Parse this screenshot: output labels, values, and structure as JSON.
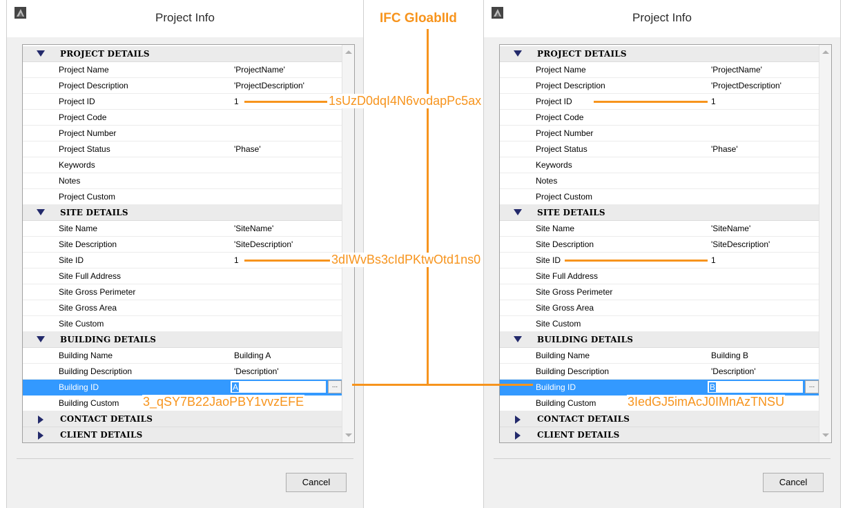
{
  "annotation_title": "IFC GloabIId",
  "annotations": {
    "project_guid": "1sUzD0dqI4N6vodapPc5ax",
    "site_guid": "3dIWvBs3cIdPKtwOtd1ns0",
    "building_guid_left": "3_qSY7B22JaoPBY1vvzEFE",
    "building_guid_right": "3IedGJ5imAcJ0IMnAzTNSU"
  },
  "colors": {
    "annotation": "#f7941d",
    "selection": "#3399ff",
    "triangle": "#232a6b"
  },
  "dialogs": [
    {
      "title": "Project Info",
      "cancel_label": "Cancel",
      "more_label": "...",
      "rows": [
        {
          "type": "section",
          "label": "PROJECT DETAILS",
          "expanded": true
        },
        {
          "label": "Project Name",
          "value": "'ProjectName'"
        },
        {
          "label": "Project Description",
          "value": "'ProjectDescription'"
        },
        {
          "label": "Project ID",
          "value": "1"
        },
        {
          "label": "Project Code",
          "value": ""
        },
        {
          "label": "Project Number",
          "value": ""
        },
        {
          "label": "Project Status",
          "value": "'Phase'"
        },
        {
          "label": "Keywords",
          "value": ""
        },
        {
          "label": "Notes",
          "value": ""
        },
        {
          "label": "Project Custom",
          "value": ""
        },
        {
          "type": "section",
          "label": "SITE DETAILS",
          "expanded": true
        },
        {
          "label": "Site Name",
          "value": "'SiteName'"
        },
        {
          "label": "Site Description",
          "value": "'SiteDescription'"
        },
        {
          "label": "Site ID",
          "value": "1"
        },
        {
          "label": "Site Full Address",
          "value": ""
        },
        {
          "label": "Site Gross Perimeter",
          "value": ""
        },
        {
          "label": "Site Gross Area",
          "value": ""
        },
        {
          "label": "Site Custom",
          "value": ""
        },
        {
          "type": "section",
          "label": "BUILDING DETAILS",
          "expanded": true
        },
        {
          "label": "Building Name",
          "value": "Building A"
        },
        {
          "label": "Building Description",
          "value": "'Description'"
        },
        {
          "label": "Building ID",
          "value": "A",
          "selected": true
        },
        {
          "label": "Building Custom",
          "value": ""
        },
        {
          "type": "section",
          "label": "CONTACT DETAILS",
          "expanded": false
        },
        {
          "type": "section",
          "label": "CLIENT DETAILS",
          "expanded": false
        }
      ]
    },
    {
      "title": "Project Info",
      "cancel_label": "Cancel",
      "more_label": "...",
      "rows": [
        {
          "type": "section",
          "label": "PROJECT DETAILS",
          "expanded": true
        },
        {
          "label": "Project Name",
          "value": "'ProjectName'"
        },
        {
          "label": "Project Description",
          "value": "'ProjectDescription'"
        },
        {
          "label": "Project ID",
          "value": "1"
        },
        {
          "label": "Project Code",
          "value": ""
        },
        {
          "label": "Project Number",
          "value": ""
        },
        {
          "label": "Project Status",
          "value": "'Phase'"
        },
        {
          "label": "Keywords",
          "value": ""
        },
        {
          "label": "Notes",
          "value": ""
        },
        {
          "label": "Project Custom",
          "value": ""
        },
        {
          "type": "section",
          "label": "SITE DETAILS",
          "expanded": true
        },
        {
          "label": "Site Name",
          "value": "'SiteName'"
        },
        {
          "label": "Site Description",
          "value": "'SiteDescription'"
        },
        {
          "label": "Site ID",
          "value": "1"
        },
        {
          "label": "Site Full Address",
          "value": ""
        },
        {
          "label": "Site Gross Perimeter",
          "value": ""
        },
        {
          "label": "Site Gross Area",
          "value": ""
        },
        {
          "label": "Site Custom",
          "value": ""
        },
        {
          "type": "section",
          "label": "BUILDING DETAILS",
          "expanded": true
        },
        {
          "label": "Building Name",
          "value": "Building B"
        },
        {
          "label": "Building Description",
          "value": "'Description'"
        },
        {
          "label": "Building ID",
          "value": "B",
          "selected": true
        },
        {
          "label": "Building Custom",
          "value": ""
        },
        {
          "type": "section",
          "label": "CONTACT DETAILS",
          "expanded": false
        },
        {
          "type": "section",
          "label": "CLIENT DETAILS",
          "expanded": false
        }
      ]
    }
  ]
}
